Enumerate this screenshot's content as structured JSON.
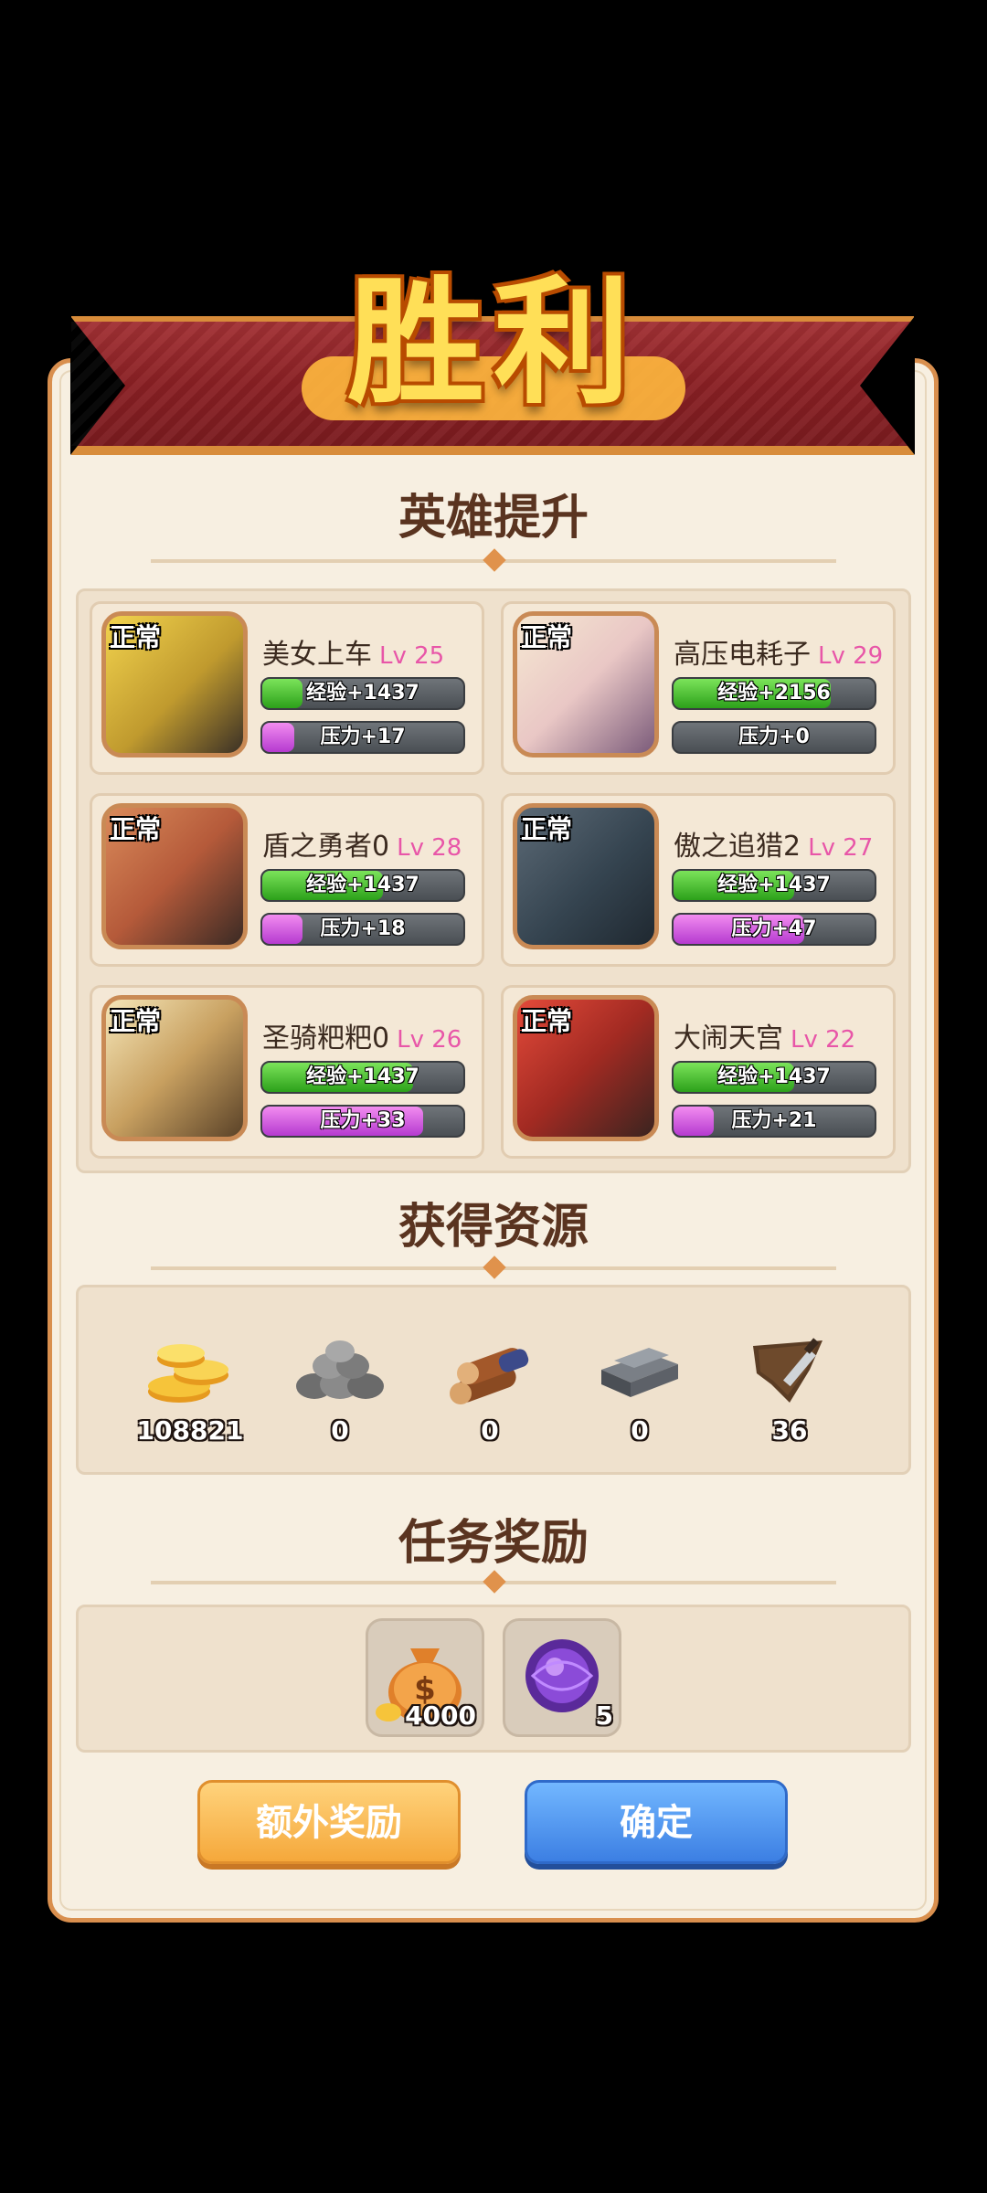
{
  "victory_title": "胜利",
  "sections": {
    "hero": "英雄提升",
    "resources": "获得资源",
    "tasks": "任务奖励"
  },
  "heroes": [
    {
      "status": "正常",
      "name": "美女上车",
      "level": "Lv 25",
      "exp": "经验+1437",
      "exp_fill": 0.2,
      "pressure": "压力+17",
      "pressure_fill": 0.16
    },
    {
      "status": "正常",
      "name": "高压电耗子",
      "level": "Lv 29",
      "exp": "经验+2156",
      "exp_fill": 0.78,
      "pressure": "压力+0",
      "pressure_fill": 0.0
    },
    {
      "status": "正常",
      "name": "盾之勇者0",
      "level": "Lv 28",
      "exp": "经验+1437",
      "exp_fill": 0.6,
      "pressure": "压力+18",
      "pressure_fill": 0.2
    },
    {
      "status": "正常",
      "name": "傲之追猎2",
      "level": "Lv 27",
      "exp": "经验+1437",
      "exp_fill": 0.6,
      "pressure": "压力+47",
      "pressure_fill": 0.65
    },
    {
      "status": "正常",
      "name": "圣骑粑粑0",
      "level": "Lv 26",
      "exp": "经验+1437",
      "exp_fill": 0.75,
      "pressure": "压力+33",
      "pressure_fill": 0.8
    },
    {
      "status": "正常",
      "name": "大闹天宫",
      "level": "Lv 22",
      "exp": "经验+1437",
      "exp_fill": 0.6,
      "pressure": "压力+21",
      "pressure_fill": 0.2
    }
  ],
  "resources": [
    {
      "icon": "gold-coins-icon",
      "value": "108821"
    },
    {
      "icon": "stone-pile-icon",
      "value": "0"
    },
    {
      "icon": "wood-logs-icon",
      "value": "0"
    },
    {
      "icon": "iron-ingot-icon",
      "value": "0"
    },
    {
      "icon": "leather-knife-icon",
      "value": "36"
    }
  ],
  "task_rewards": [
    {
      "icon": "money-bag-icon",
      "count": "4000"
    },
    {
      "icon": "purple-orb-icon",
      "count": "5"
    }
  ],
  "buttons": {
    "extra": "额外奖励",
    "confirm": "确定"
  }
}
